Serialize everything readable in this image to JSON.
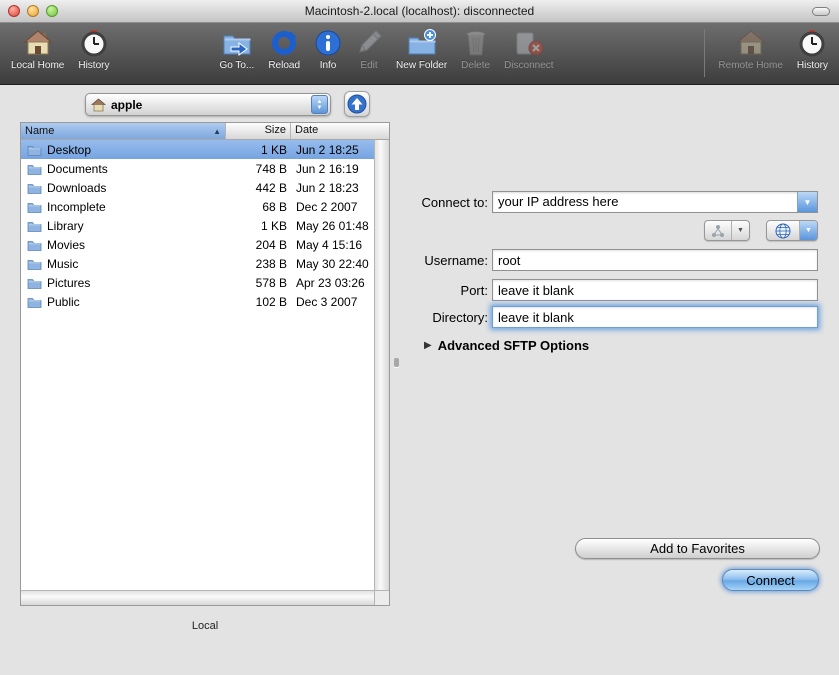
{
  "window": {
    "title": "Macintosh-2.local (localhost): disconnected"
  },
  "toolbar": {
    "items": [
      {
        "label": "Local Home",
        "icon": "house",
        "enabled": true
      },
      {
        "label": "History",
        "icon": "clock",
        "enabled": true
      },
      {
        "label": "Go To...",
        "icon": "folder-go",
        "enabled": true
      },
      {
        "label": "Reload",
        "icon": "reload-ring",
        "enabled": true
      },
      {
        "label": "Info",
        "icon": "info-circle",
        "enabled": true
      },
      {
        "label": "Edit",
        "icon": "pencil",
        "enabled": false
      },
      {
        "label": "New Folder",
        "icon": "folder-plus",
        "enabled": true
      },
      {
        "label": "Delete",
        "icon": "trash",
        "enabled": false
      },
      {
        "label": "Disconnect",
        "icon": "disconnect-x",
        "enabled": false
      },
      {
        "label": "Remote Home",
        "icon": "house",
        "enabled": false
      },
      {
        "label": "History",
        "icon": "clock",
        "enabled": false
      }
    ]
  },
  "browser": {
    "location_popup": {
      "value": "apple",
      "icon": "home-folder"
    },
    "columns": {
      "name": "Name",
      "size": "Size",
      "date": "Date"
    },
    "sort": {
      "column": "Name",
      "direction": "ascending"
    },
    "rows": [
      {
        "name": "Desktop",
        "size": "1 KB",
        "date": "Jun 2 18:25",
        "selected": true
      },
      {
        "name": "Documents",
        "size": "748 B",
        "date": "Jun 2 16:19",
        "selected": false
      },
      {
        "name": "Downloads",
        "size": "442 B",
        "date": "Jun 2 18:23",
        "selected": false
      },
      {
        "name": "Incomplete",
        "size": "68 B",
        "date": "Dec 2 2007",
        "selected": false
      },
      {
        "name": "Library",
        "size": "1 KB",
        "date": "May 26 01:48",
        "selected": false
      },
      {
        "name": "Movies",
        "size": "204 B",
        "date": "May 4 15:16",
        "selected": false
      },
      {
        "name": "Music",
        "size": "238 B",
        "date": "May 30 22:40",
        "selected": false
      },
      {
        "name": "Pictures",
        "size": "578 B",
        "date": "Apr 23 03:26",
        "selected": false
      },
      {
        "name": "Public",
        "size": "102 B",
        "date": "Dec 3 2007",
        "selected": false
      }
    ],
    "footer_label": "Local",
    "sort_arrow": "▲",
    "popup_arrow_up": "▲",
    "popup_arrow_down": "▼"
  },
  "form": {
    "connect_to_label": "Connect to:",
    "connect_to_value": "your IP address here",
    "username_label": "Username:",
    "username_value": "root",
    "port_label": "Port:",
    "port_value": "leave it blank",
    "directory_label": "Directory:",
    "directory_value": "leave it blank",
    "advanced_label": "Advanced SFTP Options",
    "disclosure_glyph": "▶",
    "dropdown_glyph": "▼",
    "add_favorites_label": "Add to Favorites",
    "connect_label": "Connect"
  },
  "colors": {
    "selection_blue": "#76a4e1",
    "aqua_button_blue": "#68a8e5",
    "toolbar_dark": "#3d3d3d",
    "header_sort_blue": "#7da7de"
  }
}
